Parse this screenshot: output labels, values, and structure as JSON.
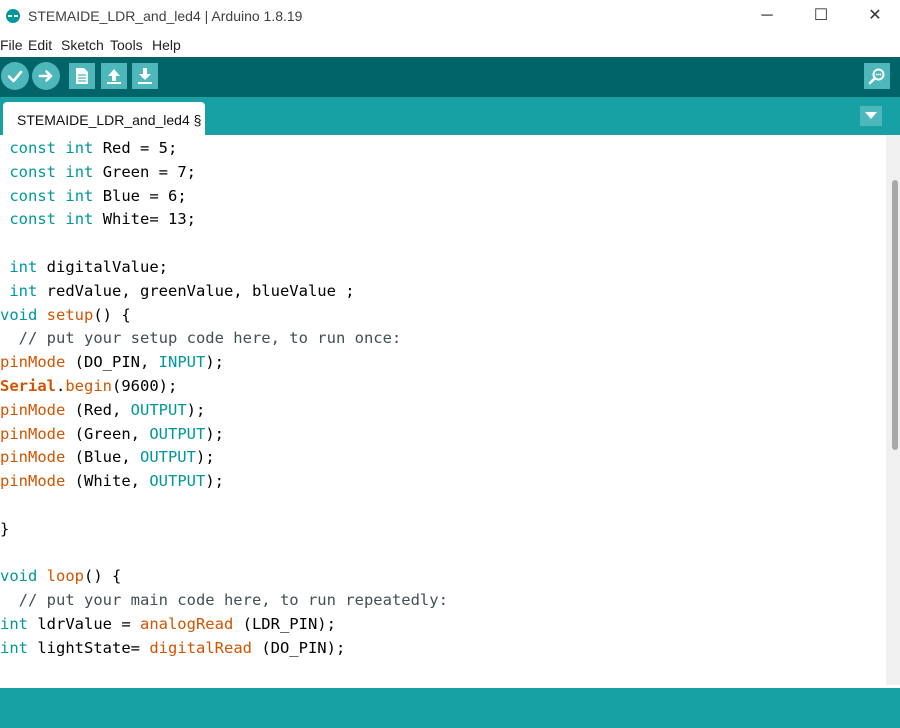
{
  "window": {
    "title": "STEMAIDE_LDR_and_led4 | Arduino 1.8.19",
    "minimize_glyph": "─",
    "maximize_glyph": "☐",
    "close_glyph": "✕"
  },
  "menu": [
    "File",
    "Edit",
    "Sketch",
    "Tools",
    "Help"
  ],
  "toolbar": {
    "buttons": [
      "verify-icon",
      "upload-icon",
      "new-icon",
      "open-icon",
      "save-icon",
      "serial-monitor-icon"
    ]
  },
  "tabs": [
    {
      "label": "STEMAIDE_LDR_and_led4 §"
    }
  ],
  "colors": {
    "toolbar_bg": "#006468",
    "tabbar_bg": "#17a1a5",
    "button_bg": "#4db7bb",
    "keyword": "#00979c",
    "function": "#d35400",
    "comment": "#434f54"
  },
  "code_lines": [
    [
      {
        "t": " "
      },
      {
        "t": "const",
        "c": "kw"
      },
      {
        "t": " "
      },
      {
        "t": "int",
        "c": "kw"
      },
      {
        "t": " Red = 5;"
      }
    ],
    [
      {
        "t": " "
      },
      {
        "t": "const",
        "c": "kw"
      },
      {
        "t": " "
      },
      {
        "t": "int",
        "c": "kw"
      },
      {
        "t": " Green = 7;"
      }
    ],
    [
      {
        "t": " "
      },
      {
        "t": "const",
        "c": "kw"
      },
      {
        "t": " "
      },
      {
        "t": "int",
        "c": "kw"
      },
      {
        "t": " Blue = 6;"
      }
    ],
    [
      {
        "t": " "
      },
      {
        "t": "const",
        "c": "kw"
      },
      {
        "t": " "
      },
      {
        "t": "int",
        "c": "kw"
      },
      {
        "t": " White= 13;"
      }
    ],
    [],
    [
      {
        "t": " "
      },
      {
        "t": "int",
        "c": "kw"
      },
      {
        "t": " digitalValue;"
      }
    ],
    [
      {
        "t": " "
      },
      {
        "t": "int",
        "c": "kw"
      },
      {
        "t": " redValue, greenValue, blueValue ;"
      }
    ],
    [
      {
        "t": "void",
        "c": "kw"
      },
      {
        "t": " "
      },
      {
        "t": "setup",
        "c": "fn"
      },
      {
        "t": "() {"
      }
    ],
    [
      {
        "t": "  // put your setup code here, to run once:",
        "c": "cm"
      }
    ],
    [
      {
        "t": "pinMode",
        "c": "fn"
      },
      {
        "t": " (DO_PIN, "
      },
      {
        "t": "INPUT",
        "c": "kw"
      },
      {
        "t": ");"
      }
    ],
    [
      {
        "t": "Serial",
        "c": "serial"
      },
      {
        "t": "."
      },
      {
        "t": "begin",
        "c": "fn"
      },
      {
        "t": "(9600);"
      }
    ],
    [
      {
        "t": "pinMode",
        "c": "fn"
      },
      {
        "t": " (Red, "
      },
      {
        "t": "OUTPUT",
        "c": "kw"
      },
      {
        "t": ");"
      }
    ],
    [
      {
        "t": "pinMode",
        "c": "fn"
      },
      {
        "t": " (Green, "
      },
      {
        "t": "OUTPUT",
        "c": "kw"
      },
      {
        "t": ");"
      }
    ],
    [
      {
        "t": "pinMode",
        "c": "fn"
      },
      {
        "t": " (Blue, "
      },
      {
        "t": "OUTPUT",
        "c": "kw"
      },
      {
        "t": ");"
      }
    ],
    [
      {
        "t": "pinMode",
        "c": "fn"
      },
      {
        "t": " (White, "
      },
      {
        "t": "OUTPUT",
        "c": "kw"
      },
      {
        "t": ");"
      }
    ],
    [],
    [
      {
        "t": "}"
      }
    ],
    [],
    [
      {
        "t": "void",
        "c": "kw"
      },
      {
        "t": " "
      },
      {
        "t": "loop",
        "c": "fn"
      },
      {
        "t": "() {"
      }
    ],
    [
      {
        "t": "  // put your main code here, to run repeatedly:",
        "c": "cm"
      }
    ],
    [
      {
        "t": "int",
        "c": "kw"
      },
      {
        "t": " ldrValue = "
      },
      {
        "t": "analogRead",
        "c": "fn"
      },
      {
        "t": " (LDR_PIN);"
      }
    ],
    [
      {
        "t": "int",
        "c": "kw"
      },
      {
        "t": " lightState= "
      },
      {
        "t": "digitalRead",
        "c": "fn"
      },
      {
        "t": " (DO_PIN);"
      }
    ]
  ]
}
